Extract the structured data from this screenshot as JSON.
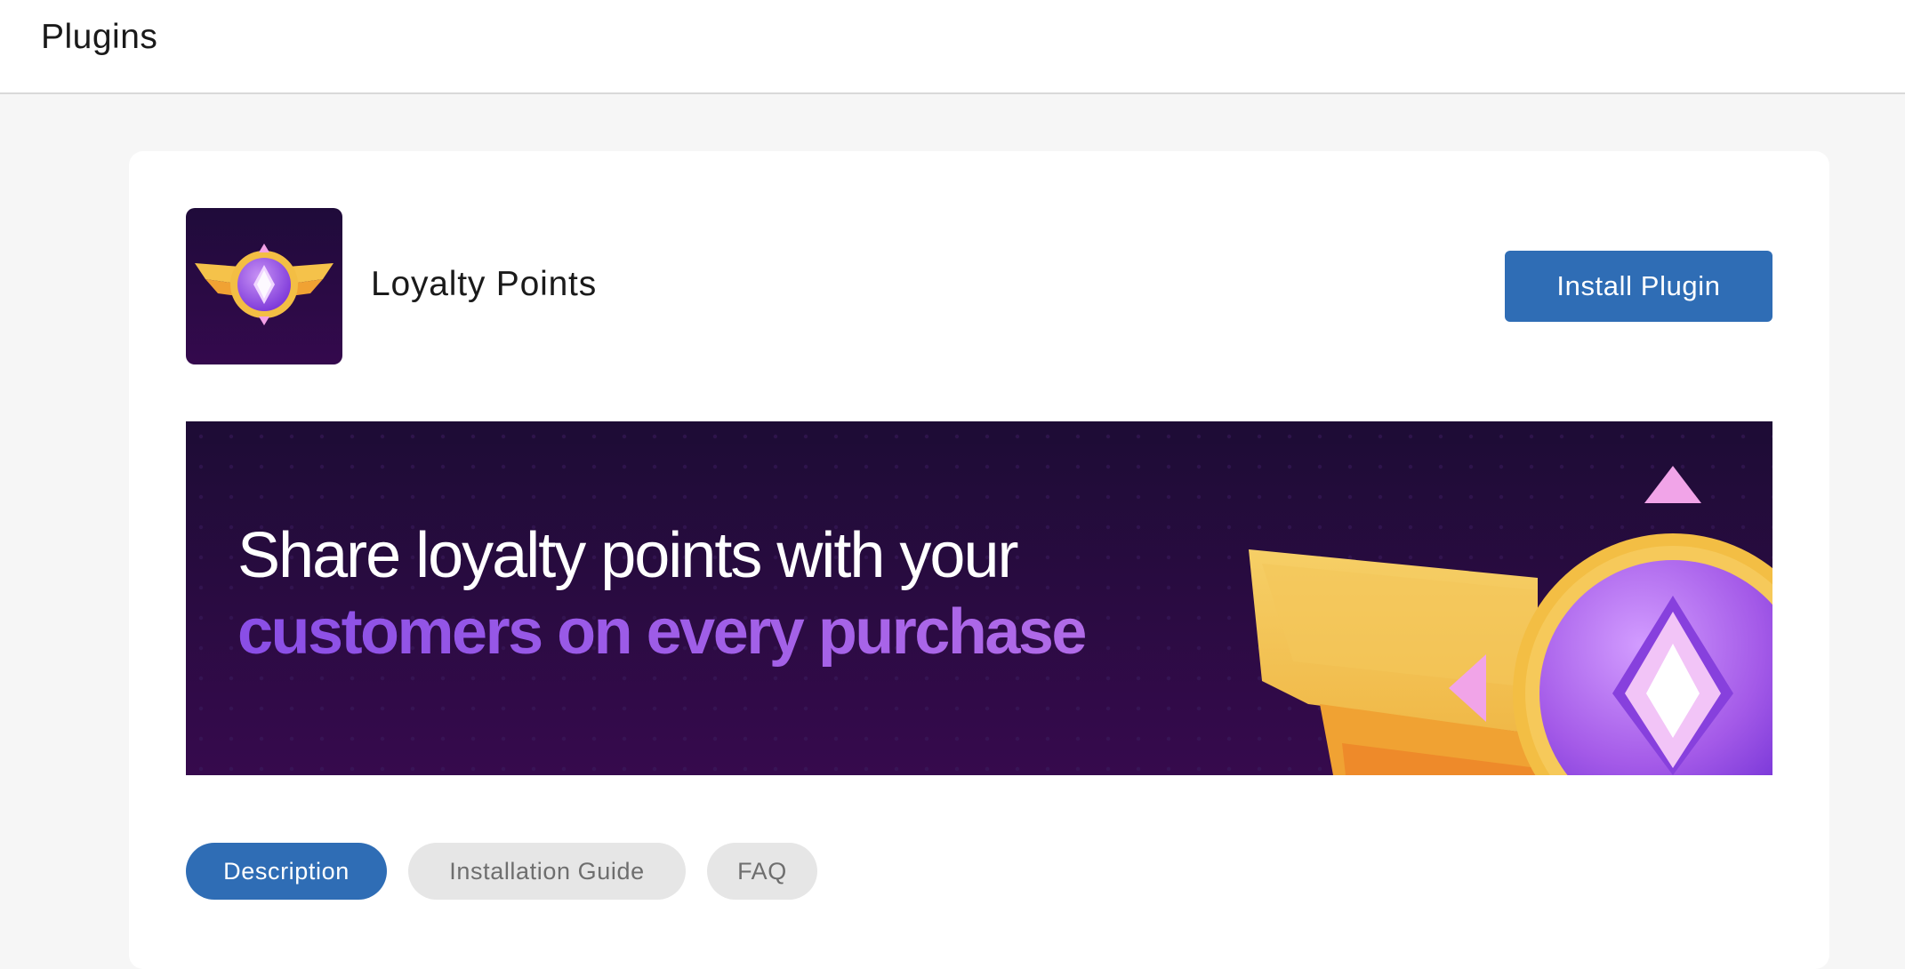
{
  "header": {
    "title": "Plugins"
  },
  "plugin": {
    "name": "Loyalty Points",
    "install_label": "Install Plugin",
    "logo_icon": "loyalty-badge-icon"
  },
  "banner": {
    "line1": "Share loyalty points with your",
    "line2": "customers on every purchase"
  },
  "tabs": [
    {
      "label": "Description",
      "active": true
    },
    {
      "label": "Installation Guide",
      "active": false
    },
    {
      "label": "FAQ",
      "active": false
    }
  ],
  "colors": {
    "accent": "#2f6db5",
    "banner_bg": "#2a0b45",
    "highlight_text": "#a461e8",
    "gold": "#f2b33d",
    "gem": "#9b57e6"
  }
}
